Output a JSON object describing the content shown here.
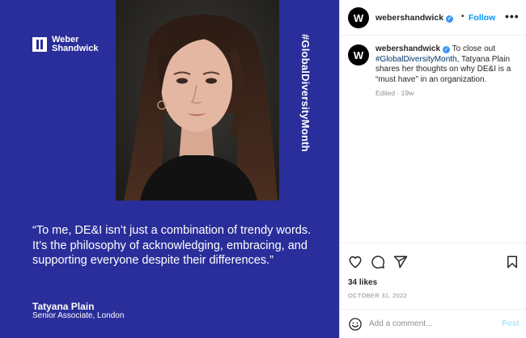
{
  "media": {
    "brand": "Weber\nShandwick",
    "hashtag": "#GlobalDiversityMonth",
    "quote": "“To me, DE&I isn’t just a combination of trendy words. It’s the philosophy of acknowledging, embracing, and supporting everyone despite their differences.”",
    "author_name": "Tatyana Plain",
    "author_role": "Senior Associate, London",
    "colors": {
      "background": "#2a2e9a",
      "text": "#ffffff"
    }
  },
  "header": {
    "avatar_letter": "W",
    "username": "webershandwick",
    "verified_icon": "verified-badge-icon",
    "separator": "•",
    "follow_label": "Follow",
    "more_icon": "•••"
  },
  "caption": {
    "avatar_letter": "W",
    "username": "webershandwick",
    "text_before": " To close out ",
    "hashtag": "#GlobalDiversityMonth",
    "text_after": ", Tatyana Plain shares her thoughts on why DE&I is a “must have” in an organization.",
    "meta": "Edited · 19w"
  },
  "actions": {
    "icons": [
      "heart-icon",
      "comment-icon",
      "share-icon",
      "bookmark-icon"
    ],
    "likes": "34 likes",
    "date": "OCTOBER 31, 2022"
  },
  "comment": {
    "placeholder": "Add a comment...",
    "post_label": "Post",
    "emoji_icon": "emoji-icon"
  },
  "colors": {
    "link": "#0095f6",
    "verified": "#3897f0",
    "muted": "#8e8e8e",
    "post_disabled": "#b2dffc"
  }
}
